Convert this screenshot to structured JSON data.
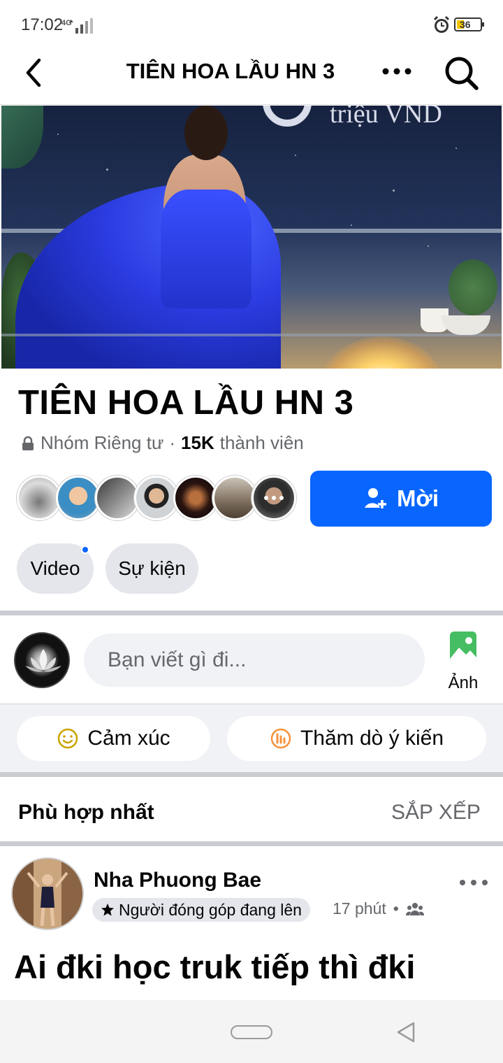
{
  "status": {
    "time": "17:02",
    "network": "4G",
    "battery": "36"
  },
  "appbar": {
    "title": "TIÊN HOA LẦU HN 3"
  },
  "cover": {
    "caption": "triệu VND"
  },
  "group": {
    "name": "TIÊN HOA LẦU HN 3",
    "privacy": "Nhóm Riêng tư",
    "separator": "·",
    "member_count": "15K",
    "member_label": "thành viên",
    "invite_label": "Mời"
  },
  "chips": {
    "video": "Video",
    "events": "Sự kiện"
  },
  "composer": {
    "placeholder": "Bạn viết gì đi...",
    "photo_label": "Ảnh"
  },
  "actions": {
    "mood": "Cảm xúc",
    "poll": "Thăm dò ý kiến"
  },
  "sort": {
    "label": "Phù hợp nhất",
    "button": "SẮP XẾP"
  },
  "post": {
    "author": "Nha Phuong Bae",
    "badge": "Người đóng góp đang lên",
    "time": "17 phút",
    "dot": "•",
    "text": "Ai đki học truk tiếp thì đki"
  },
  "colors": {
    "accent": "#0866ff",
    "chip_bg": "#e4e6eb",
    "mood_icon": "#c9a400",
    "poll_icon": "#f7923b",
    "photo_icon": "#45bd62"
  }
}
